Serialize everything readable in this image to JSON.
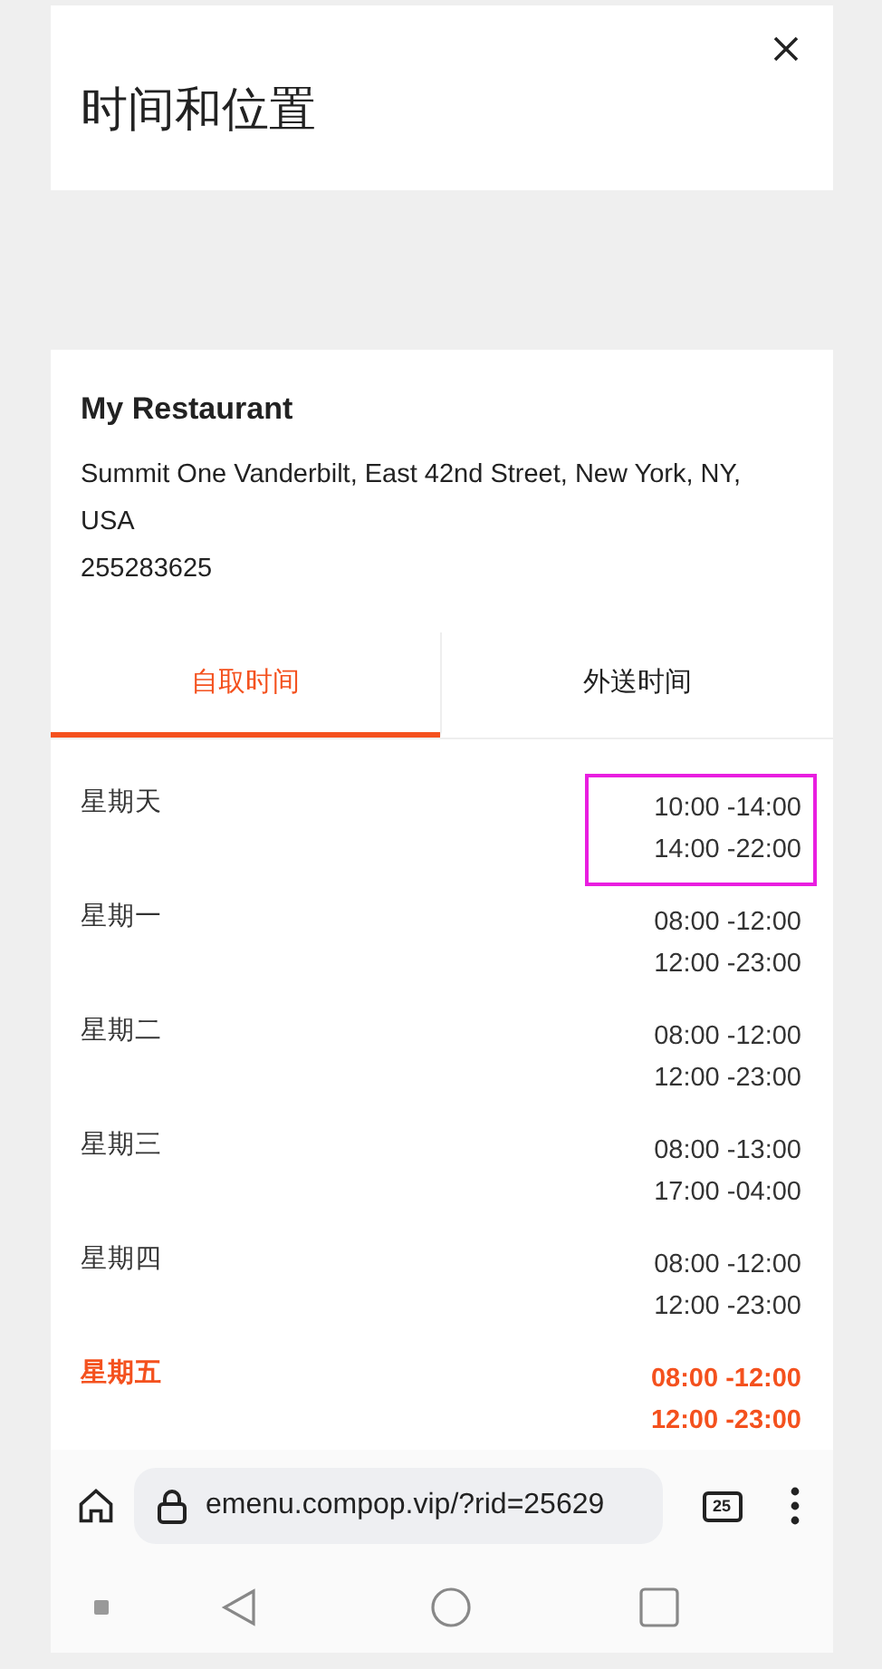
{
  "header": {
    "title": "时间和位置"
  },
  "restaurant": {
    "name": "My Restaurant",
    "address": "Summit One Vanderbilt, East 42nd Street, New York, NY, USA",
    "phone": "255283625"
  },
  "tabs": [
    {
      "label": "自取时间",
      "selected": true
    },
    {
      "label": "外送时间",
      "selected": false
    }
  ],
  "hours": [
    {
      "day": "星期天",
      "times": [
        "10:00 -14:00",
        "14:00 -22:00"
      ],
      "today": false,
      "highlighted": true
    },
    {
      "day": "星期一",
      "times": [
        "08:00 -12:00",
        "12:00 -23:00"
      ],
      "today": false,
      "highlighted": false
    },
    {
      "day": "星期二",
      "times": [
        "08:00 -12:00",
        "12:00 -23:00"
      ],
      "today": false,
      "highlighted": false
    },
    {
      "day": "星期三",
      "times": [
        "08:00 -13:00",
        "17:00 -04:00"
      ],
      "today": false,
      "highlighted": false
    },
    {
      "day": "星期四",
      "times": [
        "08:00 -12:00",
        "12:00 -23:00"
      ],
      "today": false,
      "highlighted": false
    },
    {
      "day": "星期五",
      "times": [
        "08:00 -12:00",
        "12:00 -23:00"
      ],
      "today": true,
      "highlighted": false
    }
  ],
  "browser": {
    "url": "emenu.compop.vip/?rid=25629",
    "tab_count": "25"
  }
}
